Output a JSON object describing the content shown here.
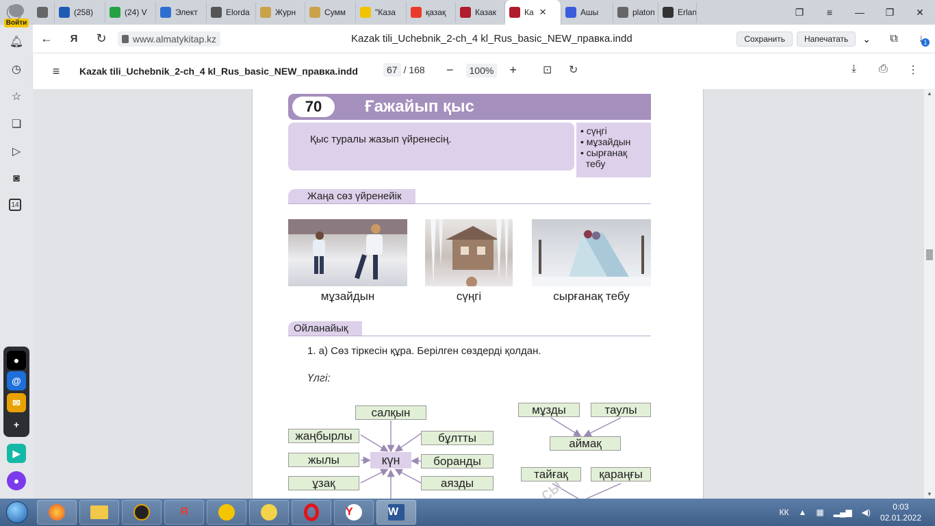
{
  "colors": {
    "lesson_purple": "#a48fbd",
    "light_purple": "#ddd0ea",
    "word_green": "#e2efd7",
    "tab_strip": "#cfd3da"
  },
  "profile": {
    "login_label": "Войти"
  },
  "tabs": [
    {
      "label": "",
      "icon": "bookmark-icon",
      "color": "#666"
    },
    {
      "label": "(258)",
      "icon": "mail-icon",
      "color": "#1e5bb5"
    },
    {
      "label": "(24) V",
      "icon": "whatsapp-icon",
      "color": "#25a244"
    },
    {
      "label": "Элект",
      "icon": "book-icon",
      "color": "#2c6fd0"
    },
    {
      "label": "Elorda",
      "icon": "tower-icon",
      "color": "#555"
    },
    {
      "label": "Журн",
      "icon": "eagle-icon",
      "color": "#c9a24a"
    },
    {
      "label": "Сумм",
      "icon": "eagle-icon",
      "color": "#c9a24a"
    },
    {
      "label": "\"Каза",
      "icon": "info-icon",
      "color": "#f2c300"
    },
    {
      "label": "қазақ",
      "icon": "yandex-icon",
      "color": "#e93b2c"
    },
    {
      "label": "Казак",
      "icon": "pdf-icon",
      "color": "#b01c2e"
    },
    {
      "label": "Ка",
      "icon": "pdf-icon",
      "color": "#b01c2e",
      "active": true
    },
    {
      "label": "Ашы",
      "icon": "u-icon",
      "color": "#3b5bdb"
    },
    {
      "label": "platon",
      "icon": "doc-icon",
      "color": "#666"
    },
    {
      "label": "Erlan",
      "icon": "edit-icon",
      "color": "#333"
    }
  ],
  "address": {
    "url": "www.almatykitap.kz",
    "title": "Kazak tili_Uchebnik_2-ch_4 kl_Rus_basic_NEW_правка.indd",
    "save_label": "Сохранить",
    "print_label": "Напечатать",
    "downloads_badge": "1"
  },
  "pdf": {
    "filename": "Kazak tili_Uchebnik_2-ch_4 kl_Rus_basic_NEW_правка.indd",
    "page_current": "67",
    "page_total": "/ 168",
    "zoom": "100%"
  },
  "sidebar": {
    "badge_number": "14"
  },
  "lesson": {
    "number": "70",
    "title": "Ғажайып қыс",
    "goal": "Қыс туралы жазып үйренесің.",
    "vocab": [
      "• сүңгі",
      "• мұзайдын",
      "• сырғанақ",
      "  тебу"
    ],
    "section_new_words": "Жаңа сөз үйренейік",
    "captions": [
      "мұзайдын",
      "сүңгі",
      "сырғанақ тебу"
    ],
    "section_think": "Ойланайық",
    "task": "1. а) Сөз тіркесін құра. Берілген сөздерді қолдан.",
    "sample_label": "Үлгі:",
    "center_word": "күн",
    "left_words": [
      "жаңбырлы",
      "жылы",
      "ұзақ"
    ],
    "top_word": "салқын",
    "right_words": [
      "бұлтты",
      "боранды",
      "аязды"
    ],
    "group2_top": [
      "мұзды",
      "таулы"
    ],
    "group2_center": "аймақ",
    "group3_top": [
      "тайғақ",
      "қараңғы"
    ],
    "watermark": "сы"
  },
  "taskbar": {
    "lang": "КК",
    "time": "0:03",
    "date": "02.01.2022",
    "apps": [
      "firefox-icon",
      "explorer-icon",
      "aimp-icon",
      "yandex-icon",
      "pro-icon",
      "yandex-disk-icon",
      "opera-icon",
      "yandex-browser-icon",
      "word-icon"
    ]
  }
}
